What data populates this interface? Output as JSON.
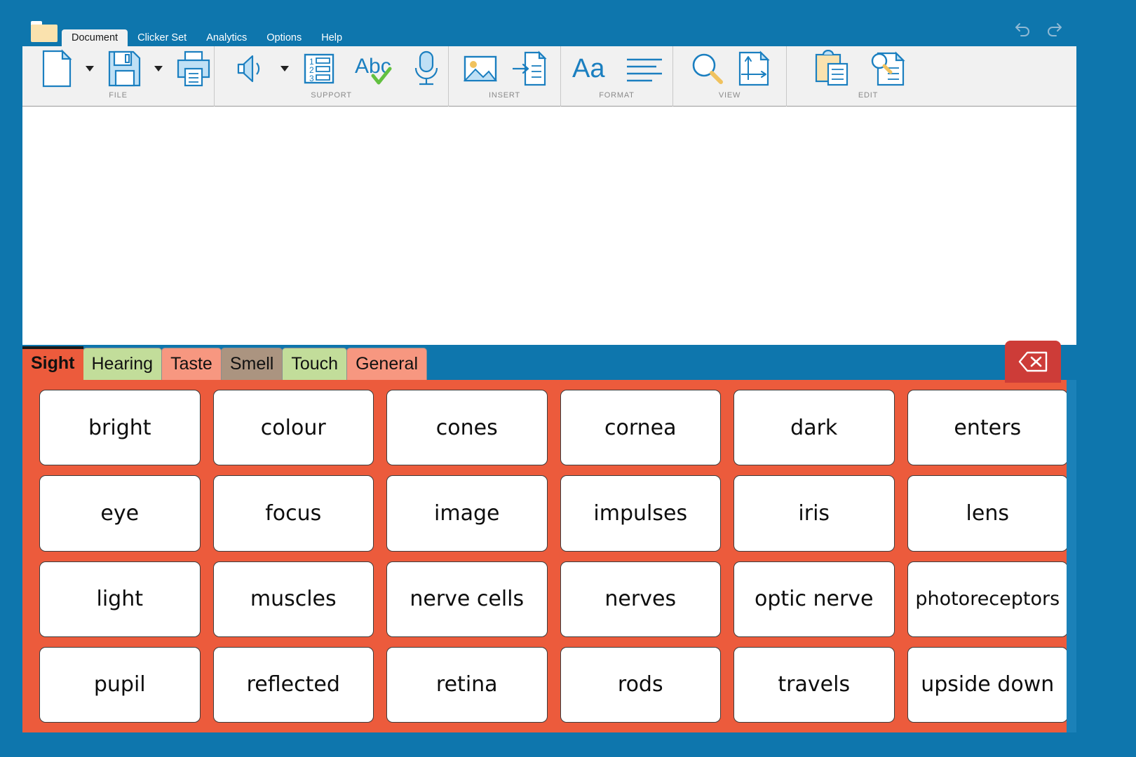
{
  "window": {
    "chrome_color": "#0e76ad",
    "folder_icon": "folder-icon"
  },
  "menu": {
    "items": [
      {
        "label": "Document",
        "active": true
      },
      {
        "label": "Clicker Set",
        "active": false
      },
      {
        "label": "Analytics",
        "active": false
      },
      {
        "label": "Options",
        "active": false
      },
      {
        "label": "Help",
        "active": false
      }
    ],
    "undo": "undo-icon",
    "redo": "redo-icon"
  },
  "ribbon": {
    "groups": [
      {
        "label": "FILE",
        "items": [
          {
            "icon": "new-document-icon",
            "caret": true
          },
          {
            "icon": "save-floppy-icon",
            "caret": true
          },
          {
            "icon": "print-icon",
            "caret": false
          }
        ]
      },
      {
        "label": "SUPPORT",
        "items": [
          {
            "icon": "speaker-icon",
            "caret": true
          },
          {
            "icon": "numbered-list-icon",
            "caret": false
          },
          {
            "icon": "spellcheck-abc-icon",
            "caret": false
          },
          {
            "icon": "microphone-icon",
            "caret": false
          }
        ]
      },
      {
        "label": "INSERT",
        "items": [
          {
            "icon": "picture-icon",
            "caret": false
          },
          {
            "icon": "insert-document-icon",
            "caret": false
          }
        ]
      },
      {
        "label": "FORMAT",
        "items": [
          {
            "icon": "font-aa-icon",
            "caret": false
          },
          {
            "icon": "paragraph-lines-icon",
            "caret": false
          }
        ]
      },
      {
        "label": "VIEW",
        "items": [
          {
            "icon": "magnifier-zoom-icon",
            "caret": false
          },
          {
            "icon": "page-layout-icon",
            "caret": false
          }
        ]
      },
      {
        "label": "EDIT",
        "items": [
          {
            "icon": "clipboard-paste-icon",
            "caret": false
          },
          {
            "icon": "find-replace-icon",
            "caret": false
          }
        ]
      }
    ]
  },
  "document": {
    "content": ""
  },
  "wordbank": {
    "tabs": [
      {
        "label": "Sight",
        "color": "#ec5b3c",
        "active": true
      },
      {
        "label": "Hearing",
        "color": "#c2dd9a",
        "active": false
      },
      {
        "label": "Taste",
        "color": "#f79780",
        "active": false
      },
      {
        "label": "Smell",
        "color": "#ab9480",
        "active": false
      },
      {
        "label": "Touch",
        "color": "#c2dd9a",
        "active": false
      },
      {
        "label": "General",
        "color": "#f79780",
        "active": false
      }
    ],
    "delete_button": {
      "icon": "backspace-icon",
      "color": "#cd3c38"
    },
    "panel_color": "#ec5b3c",
    "scrollbar": "vertical-scrollbar",
    "columns": 6,
    "rows": 4,
    "words": [
      "bright",
      "colour",
      "cones",
      "cornea",
      "dark",
      "enters",
      "eye",
      "focus",
      "image",
      "impulses",
      "iris",
      "lens",
      "light",
      "muscles",
      "nerve cells",
      "nerves",
      "optic nerve",
      "photoreceptors",
      "pupil",
      "reflected",
      "retina",
      "rods",
      "travels",
      "upside down"
    ]
  }
}
